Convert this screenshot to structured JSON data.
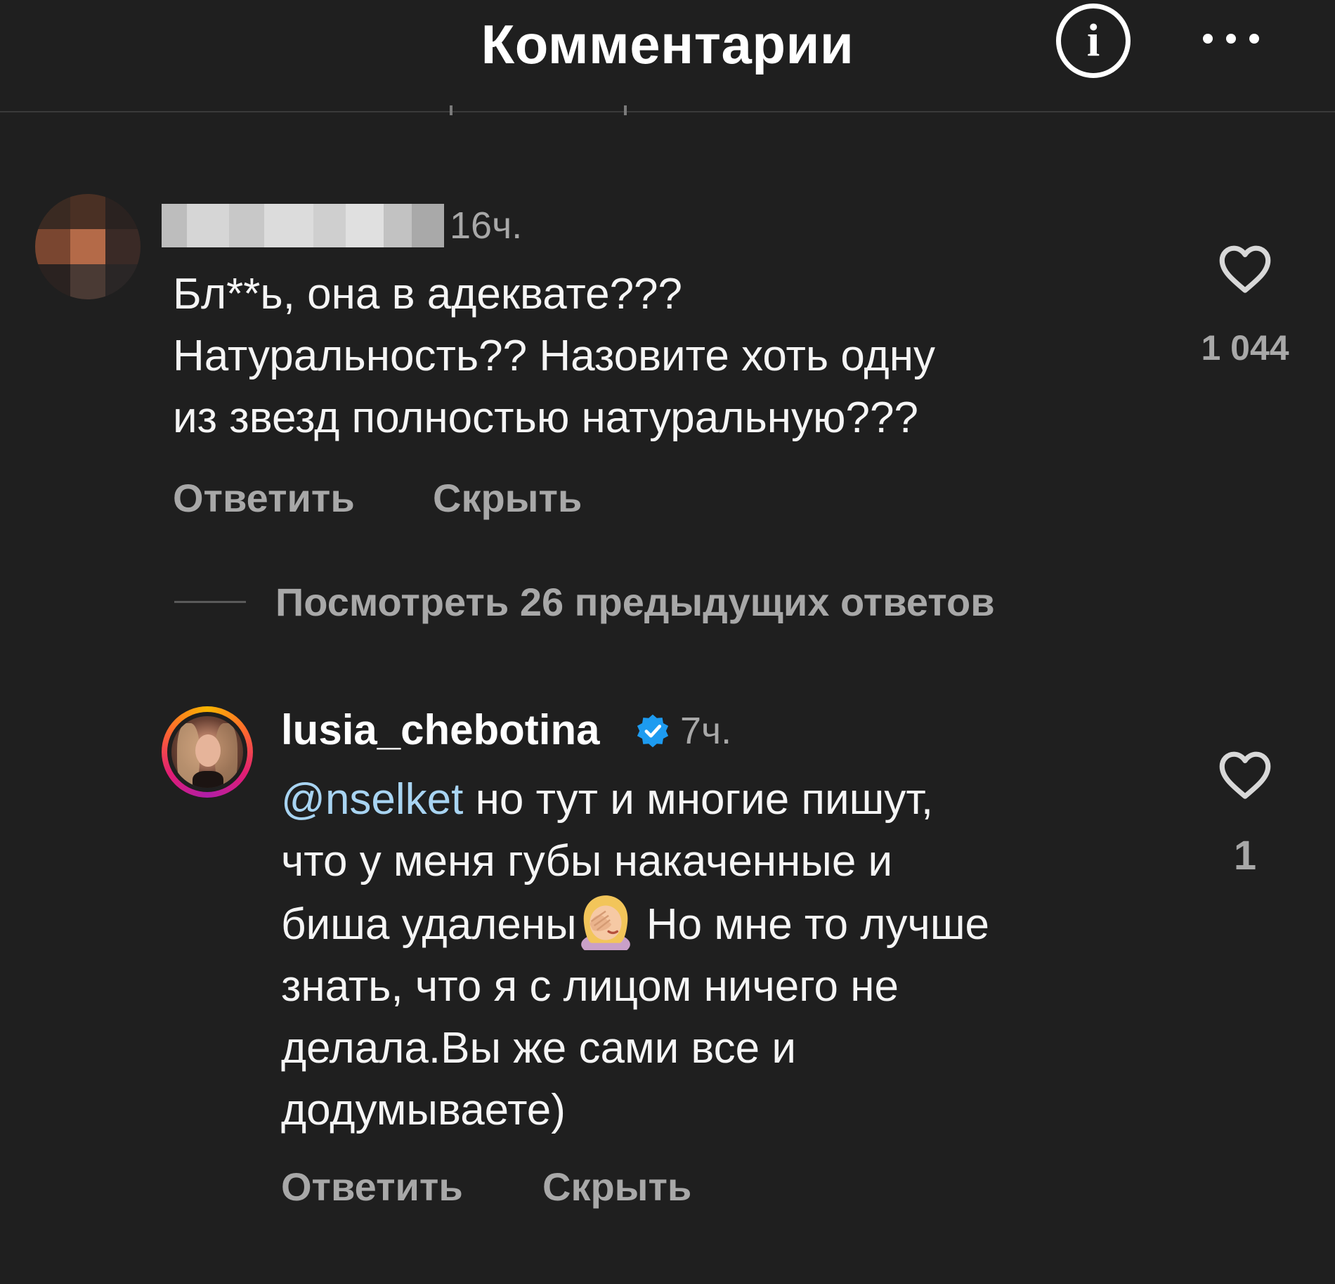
{
  "header": {
    "title": "Комментарии",
    "info_icon_glyph": "i"
  },
  "comments": [
    {
      "username": "",
      "time": "16ч.",
      "lines": [
        "Бл**ь, она в адеквате???",
        "Натуральность?? Назовите хоть одну",
        "из звезд полностью натуральную???"
      ],
      "reply_label": "Ответить",
      "hide_label": "Скрыть",
      "likes": "1 044"
    },
    {
      "username": "lusia_chebotina",
      "verified": true,
      "time": "7ч.",
      "mention": "@nselket",
      "line1_rest": " но тут и многие пишут,",
      "line2": "что у меня губы накаченные и",
      "line3_before_emoji": "биша удалены",
      "emoji": "facepalm-emoji",
      "line3_after_emoji": " Но мне то лучше",
      "line4": "знать, что я с лицом ничего не",
      "line5": "делала.Вы же сами все и",
      "line6": "додумываете)",
      "reply_label": "Ответить",
      "hide_label": "Скрыть",
      "likes": "1"
    }
  ],
  "view_replies_label": "Посмотреть 26 предыдущих ответов",
  "colors": {
    "background": "#1f1f1f",
    "secondary_text": "#a8a8a8",
    "mention": "#a8d4f2",
    "verified": "#1d9bf0"
  }
}
